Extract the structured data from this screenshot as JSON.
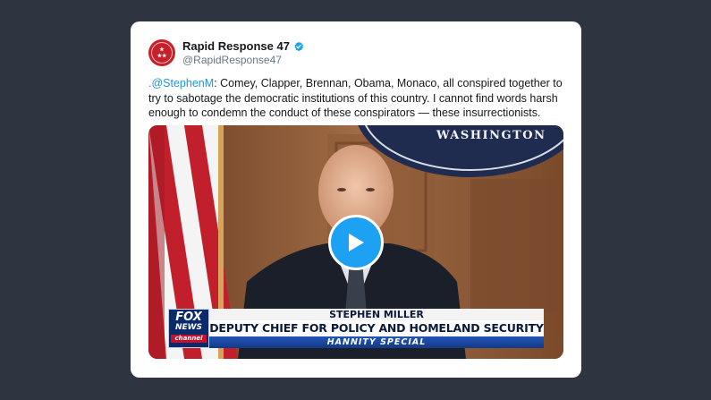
{
  "tweet": {
    "author": {
      "display_name": "Rapid Response 47",
      "handle": "@RapidResponse47",
      "verified": true,
      "avatar_icon": "white-house-seal-icon"
    },
    "text": {
      "mention": ".@StephenM",
      "body": ": Comey, Clapper, Brennan, Obama, Monaco, all conspired together to try to sabotage the democratic institutions of this country. I cannot find words harsh enough to condemn the conduct of these conspirators — these insurrectionists."
    },
    "media": {
      "type": "video",
      "play_icon": "play-icon",
      "background_sign": "WASHINGTON",
      "chyron": {
        "network_logo": [
          "FOX",
          "NEWS",
          "channel"
        ],
        "name": "STEPHEN MILLER",
        "title": "DEPUTY CHIEF FOR POLICY AND HOMELAND SECURITY ADVISOR",
        "show": "HANNITY SPECIAL"
      }
    }
  },
  "colors": {
    "page_background": "#2e3541",
    "card_background": "#ffffff",
    "mention": "#1b95e0",
    "verified_badge": "#1da1f2",
    "play_button": "#1da1f2",
    "avatar": "#c8202b"
  }
}
